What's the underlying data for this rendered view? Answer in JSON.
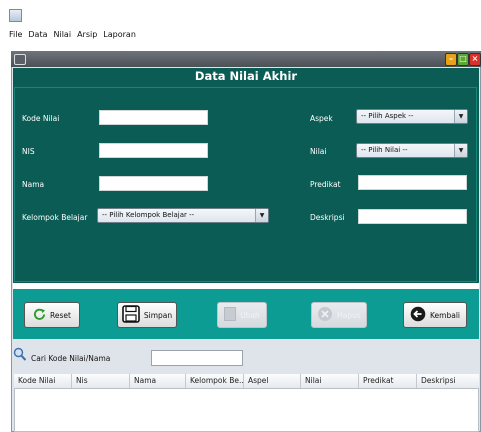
{
  "window": {
    "title": ""
  },
  "menubar": {
    "items": [
      "File",
      "Data",
      "Nilai",
      "Arsip",
      "Laporan"
    ]
  },
  "form": {
    "heading": "Data Nilai Akhir",
    "kode_nilai": {
      "label": "Kode Nilai",
      "value": ""
    },
    "nis": {
      "label": "NIS",
      "value": ""
    },
    "nama": {
      "label": "Nama",
      "value": ""
    },
    "kelompok": {
      "label": "Kelompok Belajar",
      "selected": "-- Pilih Kelompok Belajar --"
    },
    "aspek": {
      "label": "Aspek",
      "selected": "-- Pilih Aspek --"
    },
    "nilai": {
      "label": "Nilai",
      "selected": "-- Pilih Nilai --"
    },
    "predikat": {
      "label": "Predikat",
      "value": ""
    },
    "deskripsi": {
      "label": "Deskripsi",
      "value": ""
    }
  },
  "buttons": {
    "reset": "Reset",
    "simpan": "Simpan",
    "ubah": "Ubah",
    "hapus": "Hapus",
    "kembali": "Kembali"
  },
  "search": {
    "label": "Cari Kode Nilai/Nama",
    "value": ""
  },
  "table": {
    "columns": [
      "Kode Nilai",
      "Nis",
      "Nama",
      "Kelompok Be...",
      "Aspel",
      "Nilai",
      "Predikat",
      "Deskripsi"
    ]
  },
  "colors": {
    "form_bg": "#0b5c55",
    "button_bar": "#0c9c93",
    "minimize": "#e8a21a",
    "maximize": "#5aa832",
    "close": "#d9312b"
  }
}
